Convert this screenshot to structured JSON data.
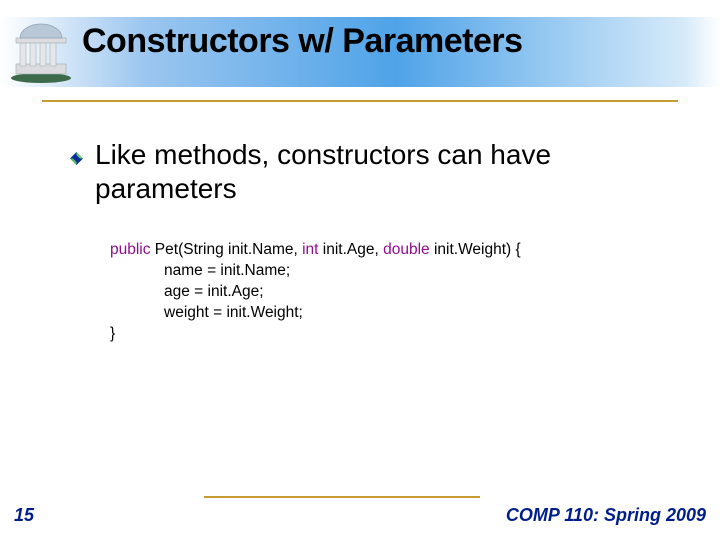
{
  "title": "Constructors w/ Parameters",
  "bullet": "Like methods, constructors can have parameters",
  "code": {
    "l1a": "public",
    "l1b": " Pet(String init.Name, ",
    "l1c": "int",
    "l1d": " init.Age, ",
    "l1e": "double",
    "l1f": " init.Weight) {",
    "l2": "name = init.Name;",
    "l3": "age = init.Age;",
    "l4": "weight = init.Weight;",
    "l5": "}"
  },
  "pageNum": "15",
  "course": "COMP 110: Spring 2009"
}
